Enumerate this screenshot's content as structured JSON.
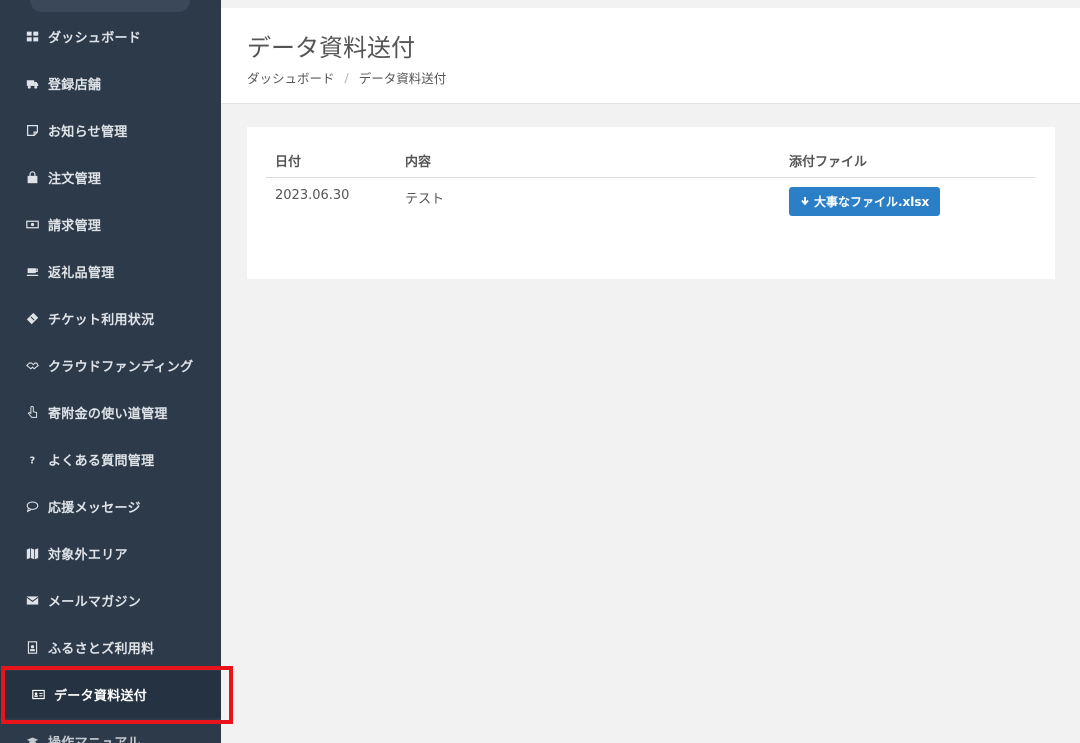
{
  "sidebar": {
    "items": [
      {
        "label": "ダッシュボード",
        "icon": "dashboard-icon"
      },
      {
        "label": "登録店舗",
        "icon": "truck-icon"
      },
      {
        "label": "お知らせ管理",
        "icon": "note-icon"
      },
      {
        "label": "注文管理",
        "icon": "shopping-bag-icon"
      },
      {
        "label": "請求管理",
        "icon": "money-icon"
      },
      {
        "label": "返礼品管理",
        "icon": "coffee-icon"
      },
      {
        "label": "チケット利用状況",
        "icon": "ticket-icon"
      },
      {
        "label": "クラウドファンディング",
        "icon": "handshake-icon"
      },
      {
        "label": "寄附金の使い道管理",
        "icon": "hand-pointer-icon"
      },
      {
        "label": "よくある質問管理",
        "icon": "question-icon"
      },
      {
        "label": "応援メッセージ",
        "icon": "comment-icon"
      },
      {
        "label": "対象外エリア",
        "icon": "map-icon"
      },
      {
        "label": "メールマガジン",
        "icon": "envelope-icon"
      },
      {
        "label": "ふるさとズ利用料",
        "icon": "id-badge-icon"
      },
      {
        "label": "データ資料送付",
        "icon": "id-card-icon",
        "active": true
      },
      {
        "label": "操作マニュアル",
        "icon": "graduation-cap-icon"
      }
    ]
  },
  "header": {
    "title": "データ資料送付",
    "breadcrumb": {
      "home": "ダッシュボード",
      "separator": "/",
      "current": "データ資料送付"
    }
  },
  "table": {
    "columns": [
      "日付",
      "内容",
      "添付ファイル"
    ],
    "rows": [
      {
        "date": "2023.06.30",
        "content": "テスト",
        "file": "大事なファイル.xlsx"
      }
    ]
  },
  "colors": {
    "sidebar_bg": "#2d3a4a",
    "sidebar_active_bg": "#253241",
    "highlight": "#e8141c",
    "button_primary": "#2b7fc6"
  }
}
